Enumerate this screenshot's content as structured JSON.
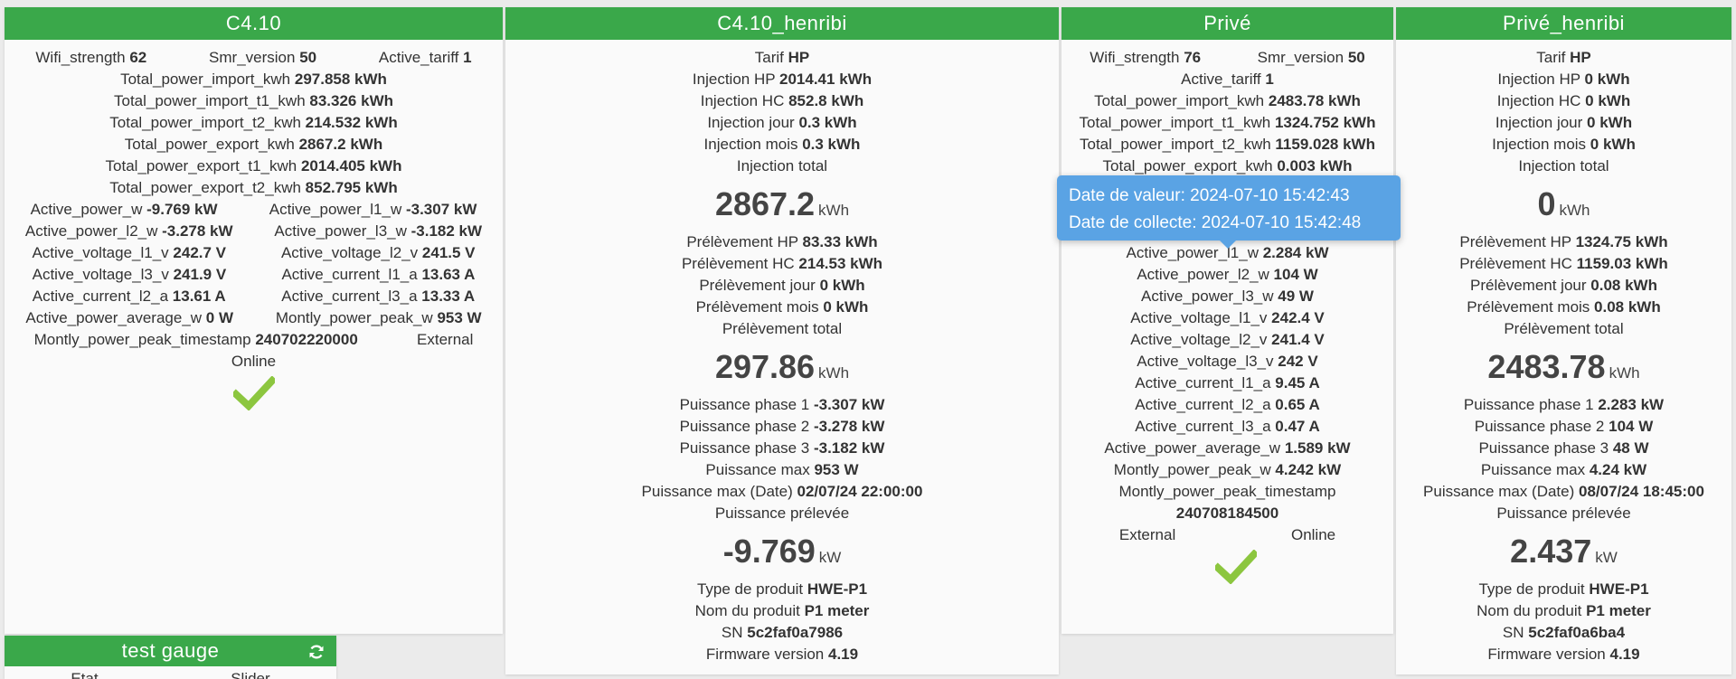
{
  "cards": {
    "c410": {
      "title": "C4.10",
      "wifi_label": "Wifi_strength",
      "wifi_value": "62",
      "smr_label": "Smr_version",
      "smr_value": "50",
      "tariff_label": "Active_tariff",
      "tariff_value": "1",
      "imp_label": "Total_power_import_kwh",
      "imp_value": "297.858 kWh",
      "imp1_label": "Total_power_import_t1_kwh",
      "imp1_value": "83.326 kWh",
      "imp2_label": "Total_power_import_t2_kwh",
      "imp2_value": "214.532 kWh",
      "exp_label": "Total_power_export_kwh",
      "exp_value": "2867.2 kWh",
      "exp1_label": "Total_power_export_t1_kwh",
      "exp1_value": "2014.405 kWh",
      "exp2_label": "Total_power_export_t2_kwh",
      "exp2_value": "852.795 kWh",
      "pw_label": "Active_power_w",
      "pw_value": "-9.769 kW",
      "pl1_label": "Active_power_l1_w",
      "pl1_value": "-3.307 kW",
      "pl2_label": "Active_power_l2_w",
      "pl2_value": "-3.278 kW",
      "pl3_label": "Active_power_l3_w",
      "pl3_value": "-3.182 kW",
      "v1_label": "Active_voltage_l1_v",
      "v1_value": "242.7 V",
      "v2_label": "Active_voltage_l2_v",
      "v2_value": "241.5 V",
      "v3_label": "Active_voltage_l3_v",
      "v3_value": "241.9 V",
      "a1_label": "Active_current_l1_a",
      "a1_value": "13.63 A",
      "a2_label": "Active_current_l2_a",
      "a2_value": "13.61 A",
      "a3_label": "Active_current_l3_a",
      "a3_value": "13.33 A",
      "avg_label": "Active_power_average_w",
      "avg_value": "0 W",
      "peak_label": "Montly_power_peak_w",
      "peak_value": "953 W",
      "ts_label": "Montly_power_peak_timestamp",
      "ts_value": "240702220000",
      "external": "External",
      "online": "Online"
    },
    "c410_henribi": {
      "title": "C4.10_henribi",
      "tarif_label": "Tarif",
      "tarif_value": "HP",
      "inj_hp_label": "Injection HP",
      "inj_hp_value": "2014.41 kWh",
      "inj_hc_label": "Injection HC",
      "inj_hc_value": "852.8 kWh",
      "inj_jour_label": "Injection jour",
      "inj_jour_value": "0.3 kWh",
      "inj_mois_label": "Injection mois",
      "inj_mois_value": "0.3 kWh",
      "inj_total_label": "Injection total",
      "inj_total_num": "2867.2",
      "inj_total_unit": "kWh",
      "pre_hp_label": "Prélèvement HP",
      "pre_hp_value": "83.33 kWh",
      "pre_hc_label": "Prélèvement HC",
      "pre_hc_value": "214.53 kWh",
      "pre_jour_label": "Prélèvement jour",
      "pre_jour_value": "0 kWh",
      "pre_mois_label": "Prélèvement mois",
      "pre_mois_value": "0 kWh",
      "pre_total_label": "Prélèvement total",
      "pre_total_num": "297.86",
      "pre_total_unit": "kWh",
      "ph1_label": "Puissance phase 1",
      "ph1_value": "-3.307 kW",
      "ph2_label": "Puissance phase 2",
      "ph2_value": "-3.278 kW",
      "ph3_label": "Puissance phase 3",
      "ph3_value": "-3.182 kW",
      "pmax_label": "Puissance max",
      "pmax_value": "953 W",
      "pmax_date_label": "Puissance max (Date)",
      "pmax_date_value": "02/07/24 22:00:00",
      "pprel_label": "Puissance prélevée",
      "pprel_num": "-9.769",
      "pprel_unit": "kW",
      "type_label": "Type de produit",
      "type_value": "HWE-P1",
      "nom_label": "Nom du produit",
      "nom_value": "P1 meter",
      "sn_label": "SN",
      "sn_value": "5c2faf0a7986",
      "fw_label": "Firmware version",
      "fw_value": "4.19"
    },
    "prive": {
      "title": "Privé",
      "wifi_label": "Wifi_strength",
      "wifi_value": "76",
      "smr_label": "Smr_version",
      "smr_value": "50",
      "tariff_label": "Active_tariff",
      "tariff_value": "1",
      "imp_label": "Total_power_import_kwh",
      "imp_value": "2483.78 kWh",
      "imp1_label": "Total_power_import_t1_kwh",
      "imp1_value": "1324.752 kWh",
      "imp2_label": "Total_power_import_t2_kwh",
      "imp2_value": "1159.028 kWh",
      "exp_label": "Total_power_export_kwh",
      "exp_value": "0.003 kWh",
      "pl1_label": "Active_power_l1_w",
      "pl1_value": "2.284 kW",
      "pl2_label": "Active_power_l2_w",
      "pl2_value": "104 W",
      "pl3_label": "Active_power_l3_w",
      "pl3_value": "49 W",
      "v1_label": "Active_voltage_l1_v",
      "v1_value": "242.4 V",
      "v2_label": "Active_voltage_l2_v",
      "v2_value": "241.4 V",
      "v3_label": "Active_voltage_l3_v",
      "v3_value": "242 V",
      "a1_label": "Active_current_l1_a",
      "a1_value": "9.45 A",
      "a2_label": "Active_current_l2_a",
      "a2_value": "0.65 A",
      "a3_label": "Active_current_l3_a",
      "a3_value": "0.47 A",
      "avg_label": "Active_power_average_w",
      "avg_value": "1.589 kW",
      "peak_label": "Montly_power_peak_w",
      "peak_value": "4.242 kW",
      "ts_label": "Montly_power_peak_timestamp",
      "ts_value": "240708184500",
      "external": "External",
      "online": "Online"
    },
    "prive_henribi": {
      "title": "Privé_henribi",
      "tarif_label": "Tarif",
      "tarif_value": "HP",
      "inj_hp_label": "Injection HP",
      "inj_hp_value": "0 kWh",
      "inj_hc_label": "Injection HC",
      "inj_hc_value": "0 kWh",
      "inj_jour_label": "Injection jour",
      "inj_jour_value": "0 kWh",
      "inj_mois_label": "Injection mois",
      "inj_mois_value": "0 kWh",
      "inj_total_label": "Injection total",
      "inj_total_num": "0",
      "inj_total_unit": "kWh",
      "pre_hp_label": "Prélèvement HP",
      "pre_hp_value": "1324.75 kWh",
      "pre_hc_label": "Prélèvement HC",
      "pre_hc_value": "1159.03 kWh",
      "pre_jour_label": "Prélèvement jour",
      "pre_jour_value": "0.08 kWh",
      "pre_mois_label": "Prélèvement mois",
      "pre_mois_value": "0.08 kWh",
      "pre_total_label": "Prélèvement total",
      "pre_total_num": "2483.78",
      "pre_total_unit": "kWh",
      "ph1_label": "Puissance phase 1",
      "ph1_value": "2.283 kW",
      "ph2_label": "Puissance phase 2",
      "ph2_value": "104 W",
      "ph3_label": "Puissance phase 3",
      "ph3_value": "48 W",
      "pmax_label": "Puissance max",
      "pmax_value": "4.24 kW",
      "pmax_date_label": "Puissance max (Date)",
      "pmax_date_value": "08/07/24 18:45:00",
      "pprel_label": "Puissance prélevée",
      "pprel_num": "2.437",
      "pprel_unit": "kW",
      "type_label": "Type de produit",
      "type_value": "HWE-P1",
      "nom_label": "Nom du produit",
      "nom_value": "P1 meter",
      "sn_label": "SN",
      "sn_value": "5c2faf0a6ba4",
      "fw_label": "Firmware version",
      "fw_value": "4.19"
    },
    "gauge": {
      "title": "test gauge",
      "col1": "Etat",
      "col2": "Slider"
    }
  },
  "tooltip": {
    "line1": "Date de valeur: 2024-07-10 15:42:43",
    "line2": "Date de collecte: 2024-07-10 15:42:48"
  },
  "colors": {
    "header": "#3aa84a",
    "check": "#8cc63f",
    "tooltip": "#5aa3e4"
  },
  "icons": {
    "status": "check-icon",
    "refresh": "refresh-icon"
  }
}
